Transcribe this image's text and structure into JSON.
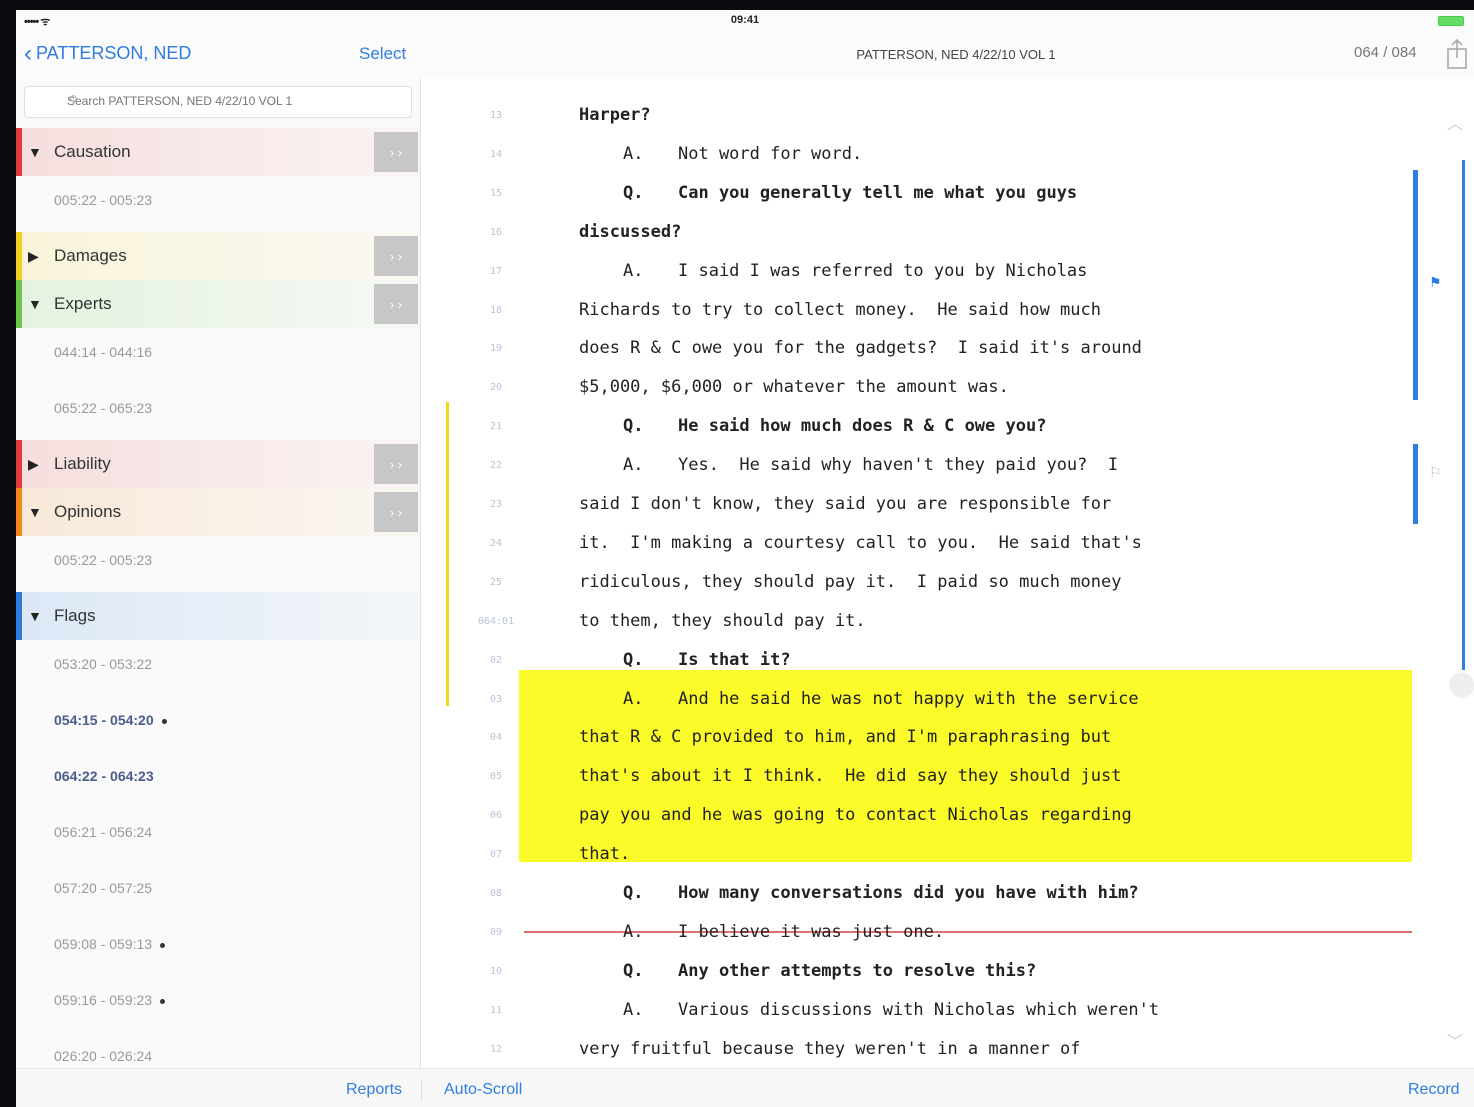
{
  "status": {
    "signal": "••••• ᯤ",
    "time": "09:41"
  },
  "nav": {
    "back_label": "PATTERSON, NED",
    "select_label": "Select",
    "title": "PATTERSON, NED 4/22/10 VOL 1",
    "page_indicator": "064 / 084"
  },
  "sidebar": {
    "search_placeholder": "Search PATTERSON, NED 4/22/10 VOL 1",
    "report_button": "› ›",
    "tags": [
      {
        "label": "Causation",
        "color": "#e03a3a",
        "expanded": true,
        "ranges": [
          "005:22 - 005:23"
        ]
      },
      {
        "label": "Damages",
        "color": "#f0d020",
        "expanded": false,
        "ranges": []
      },
      {
        "label": "Experts",
        "color": "#6cc84a",
        "expanded": true,
        "ranges": [
          "044:14 - 044:16",
          "065:22 - 065:23"
        ]
      },
      {
        "label": "Liability",
        "color": "#e03a3a",
        "expanded": false,
        "ranges": []
      },
      {
        "label": "Opinions",
        "color": "#f08a1a",
        "expanded": true,
        "ranges": [
          "005:22 - 005:23"
        ]
      }
    ],
    "flags": {
      "label": "Flags",
      "color": "#2f7de1",
      "ranges": [
        {
          "text": "053:20 - 053:22",
          "bold": false,
          "dot": false
        },
        {
          "text": "054:15 - 054:20",
          "bold": true,
          "dot": true
        },
        {
          "text": "064:22 - 064:23",
          "bold": true,
          "dot": false
        },
        {
          "text": "056:21 - 056:24",
          "bold": false,
          "dot": false
        },
        {
          "text": "057:20 - 057:25",
          "bold": false,
          "dot": false
        },
        {
          "text": "059:08 - 059:13",
          "bold": false,
          "dot": true
        },
        {
          "text": "059:16 - 059:23",
          "bold": false,
          "dot": true
        },
        {
          "text": "026:20 - 026:24",
          "bold": false,
          "dot": false
        }
      ]
    }
  },
  "transcript": {
    "lines": [
      {
        "num": "13",
        "prefix": "",
        "text": "Harper?",
        "bold": true,
        "indent": 0
      },
      {
        "num": "14",
        "prefix": "A.",
        "text": "Not word for word.",
        "bold": false,
        "indent": 1
      },
      {
        "num": "15",
        "prefix": "Q.",
        "text": "Can you generally tell me what you guys",
        "bold": true,
        "indent": 1
      },
      {
        "num": "16",
        "prefix": "",
        "text": "discussed?",
        "bold": true,
        "indent": 0
      },
      {
        "num": "17",
        "prefix": "A.",
        "text": "I said I was referred to you by Nicholas",
        "bold": false,
        "indent": 1
      },
      {
        "num": "18",
        "prefix": "",
        "text": "Richards to try to collect money.  He said how much",
        "bold": false,
        "indent": 0
      },
      {
        "num": "19",
        "prefix": "",
        "text": "does R & C owe you for the gadgets?  I said it's around",
        "bold": false,
        "indent": 0
      },
      {
        "num": "20",
        "prefix": "",
        "text": "$5,000, $6,000 or whatever the amount was.",
        "bold": false,
        "indent": 0
      },
      {
        "num": "21",
        "prefix": "Q.",
        "text": "He said how much does R & C owe you?",
        "bold": true,
        "indent": 1
      },
      {
        "num": "22",
        "prefix": "A.",
        "text": "Yes.  He said why haven't they paid you?  I",
        "bold": false,
        "indent": 1
      },
      {
        "num": "23",
        "prefix": "",
        "text": "said I don't know, they said you are responsible for",
        "bold": false,
        "indent": 0
      },
      {
        "num": "24",
        "prefix": "",
        "text": "it.  I'm making a courtesy call to you.  He said that's",
        "bold": false,
        "indent": 0
      },
      {
        "num": "25",
        "prefix": "",
        "text": "ridiculous, they should pay it.  I paid so much money",
        "bold": false,
        "indent": 0
      },
      {
        "num": "064:01",
        "prefix": "",
        "text": "to them, they should pay it.",
        "bold": false,
        "indent": 0
      },
      {
        "num": "02",
        "prefix": "Q.",
        "text": "Is that it?",
        "bold": true,
        "indent": 1
      },
      {
        "num": "03",
        "prefix": "A.",
        "text": "And he said he was not happy with the service",
        "bold": false,
        "indent": 1
      },
      {
        "num": "04",
        "prefix": "",
        "text": "that R & C provided to him, and I'm paraphrasing but",
        "bold": false,
        "indent": 0
      },
      {
        "num": "05",
        "prefix": "",
        "text": "that's about it I think.  He did say they should just",
        "bold": false,
        "indent": 0
      },
      {
        "num": "06",
        "prefix": "",
        "text": "pay you and he was going to contact Nicholas regarding",
        "bold": false,
        "indent": 0
      },
      {
        "num": "07",
        "prefix": "",
        "text": "that.",
        "bold": false,
        "indent": 0
      },
      {
        "num": "08",
        "prefix": "Q.",
        "text": "How many conversations did you have with him?",
        "bold": true,
        "indent": 1
      },
      {
        "num": "09",
        "prefix": "A.",
        "text": "I believe it was just one.",
        "bold": false,
        "indent": 1
      },
      {
        "num": "10",
        "prefix": "Q.",
        "text": "Any other attempts to resolve this?",
        "bold": true,
        "indent": 1
      },
      {
        "num": "11",
        "prefix": "A.",
        "text": "Various discussions with Nicholas which weren't",
        "bold": false,
        "indent": 1
      },
      {
        "num": "12",
        "prefix": "",
        "text": "very fruitful because they weren't in a manner of",
        "bold": false,
        "indent": 0
      }
    ],
    "highlight_color": "#fbfb2a"
  },
  "toolbar": {
    "reports_label": "Reports",
    "autoscroll_label": "Auto-Scroll",
    "record_label": "Record"
  },
  "colors": {
    "accent": "#2f7de1",
    "highlight": "#fbfb2a"
  },
  "icons": {
    "back": "chevron-left-icon",
    "share": "share-icon",
    "search": "search-icon",
    "flag": "flag-icon",
    "expand": "triangle-down-icon",
    "collapse": "triangle-right-icon"
  }
}
